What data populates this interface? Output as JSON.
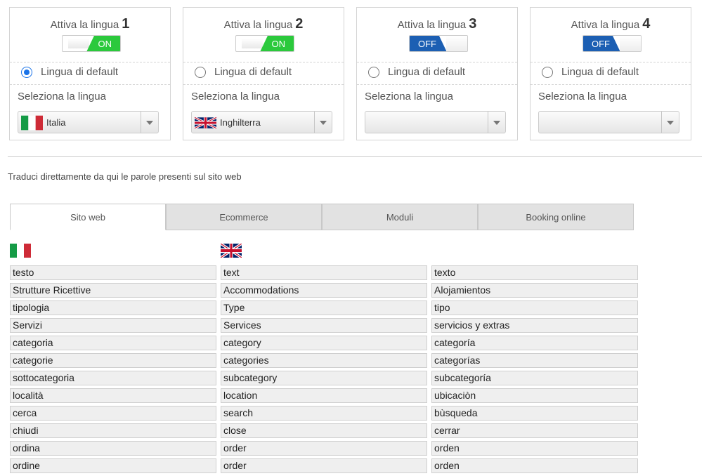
{
  "languages": [
    {
      "title": "Attiva la lingua",
      "number": "1",
      "toggle": "ON",
      "toggle_on": true,
      "default_label": "Lingua di default",
      "default_checked": true,
      "select_label": "Seleziona la lingua",
      "selected": "Italia",
      "flag": "italy-flag-icon"
    },
    {
      "title": "Attiva la lingua",
      "number": "2",
      "toggle": "ON",
      "toggle_on": true,
      "default_label": "Lingua di default",
      "default_checked": false,
      "select_label": "Seleziona la lingua",
      "selected": "Inghilterra",
      "flag": "uk-flag-icon"
    },
    {
      "title": "Attiva la lingua",
      "number": "3",
      "toggle": "OFF",
      "toggle_on": false,
      "default_label": "Lingua di default",
      "default_checked": false,
      "select_label": "Seleziona la lingua",
      "selected": "",
      "flag": ""
    },
    {
      "title": "Attiva la lingua",
      "number": "4",
      "toggle": "OFF",
      "toggle_on": false,
      "default_label": "Lingua di default",
      "default_checked": false,
      "select_label": "Seleziona la lingua",
      "selected": "",
      "flag": ""
    }
  ],
  "intro_text": "Traduci direttamente da qui le parole presenti sul sito web",
  "tabs": [
    "Sito web",
    "Ecommerce",
    "Moduli",
    "Booking online"
  ],
  "active_tab": "Sito web",
  "colors": {
    "toggle_on": "#2bc93c",
    "toggle_off": "#1c5fb3",
    "radio": "#1a73e8"
  },
  "translations": {
    "italian": [
      "testo",
      "Strutture Ricettive",
      "tipologia",
      "Servizi",
      "categoria",
      "categorie",
      "sottocategoria",
      "località",
      "cerca",
      "chiudi",
      "ordina",
      "ordine"
    ],
    "english": [
      "text",
      "Accommodations",
      "Type",
      "Services",
      "category",
      "categories",
      "subcategory",
      "location",
      "search",
      "close",
      "order",
      "order"
    ],
    "spanish": [
      "texto",
      "Alojamientos",
      "tipo",
      "servicios y extras",
      "categoría",
      "categorías",
      "subcategoría",
      "ubicaciòn",
      "bùsqueda",
      "cerrar",
      "orden",
      "orden"
    ]
  }
}
